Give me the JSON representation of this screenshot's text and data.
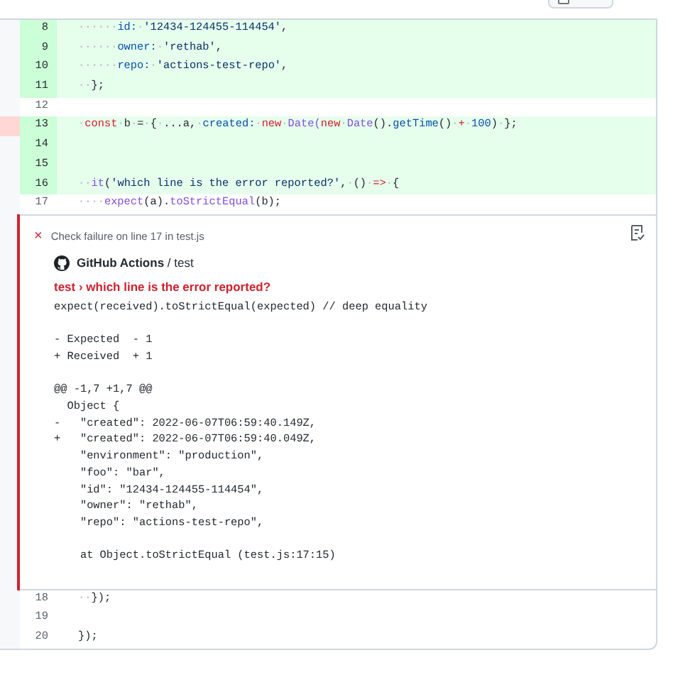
{
  "viewed_toggle": {
    "checked": false
  },
  "lines_before": [
    {
      "number": "8",
      "added": true,
      "marked": false,
      "tokens": [
        {
          "kind": "ws",
          "text": "······"
        },
        {
          "kind": "key",
          "text": "id:"
        },
        {
          "kind": "ws",
          "text": "·"
        },
        {
          "kind": "str",
          "text": "'12434-124455-114454'"
        },
        {
          "kind": "plain",
          "text": ","
        }
      ]
    },
    {
      "number": "9",
      "added": true,
      "marked": false,
      "tokens": [
        {
          "kind": "ws",
          "text": "······"
        },
        {
          "kind": "key",
          "text": "owner:"
        },
        {
          "kind": "ws",
          "text": "·"
        },
        {
          "kind": "str",
          "text": "'rethab'"
        },
        {
          "kind": "plain",
          "text": ","
        }
      ]
    },
    {
      "number": "10",
      "added": true,
      "marked": false,
      "tokens": [
        {
          "kind": "ws",
          "text": "······"
        },
        {
          "kind": "key",
          "text": "repo:"
        },
        {
          "kind": "ws",
          "text": "·"
        },
        {
          "kind": "str",
          "text": "'actions-test-repo'"
        },
        {
          "kind": "plain",
          "text": ","
        }
      ]
    },
    {
      "number": "11",
      "added": true,
      "marked": false,
      "tokens": [
        {
          "kind": "ws",
          "text": "··"
        },
        {
          "kind": "plain",
          "text": "};"
        }
      ]
    },
    {
      "number": "12",
      "added": false,
      "marked": false
    },
    {
      "number": "13",
      "added": true,
      "marked": true,
      "tokens": [
        {
          "kind": "ws",
          "text": "·"
        },
        {
          "kind": "kw",
          "text": "const"
        },
        {
          "kind": "ws",
          "text": "·"
        },
        {
          "kind": "plain",
          "text": "b"
        },
        {
          "kind": "ws",
          "text": "·"
        },
        {
          "kind": "plain",
          "text": "="
        },
        {
          "kind": "ws",
          "text": "·"
        },
        {
          "kind": "plain",
          "text": "{"
        },
        {
          "kind": "ws",
          "text": "·"
        },
        {
          "kind": "plain",
          "text": "...a,"
        },
        {
          "kind": "ws",
          "text": "·"
        },
        {
          "kind": "key",
          "text": "created:"
        },
        {
          "kind": "ws",
          "text": "·"
        },
        {
          "kind": "kw",
          "text": "new"
        },
        {
          "kind": "ws",
          "text": "·"
        },
        {
          "kind": "fn",
          "text": "Date("
        },
        {
          "kind": "kw",
          "text": "new"
        },
        {
          "kind": "ws",
          "text": "·"
        },
        {
          "kind": "fn",
          "text": "Date"
        },
        {
          "kind": "plain",
          "text": "()."
        },
        {
          "kind": "key",
          "text": "getTime"
        },
        {
          "kind": "plain",
          "text": "()"
        },
        {
          "kind": "ws",
          "text": "·"
        },
        {
          "kind": "kw",
          "text": "+"
        },
        {
          "kind": "ws",
          "text": "·"
        },
        {
          "kind": "key",
          "text": "100"
        },
        {
          "kind": "plain",
          "text": ")"
        },
        {
          "kind": "ws",
          "text": "·"
        },
        {
          "kind": "plain",
          "text": "};"
        }
      ]
    },
    {
      "number": "14",
      "added": true,
      "marked": false
    },
    {
      "number": "15",
      "added": true,
      "marked": false
    },
    {
      "number": "16",
      "added": true,
      "marked": false,
      "tokens": [
        {
          "kind": "ws",
          "text": "··"
        },
        {
          "kind": "fn",
          "text": "it"
        },
        {
          "kind": "plain",
          "text": "("
        },
        {
          "kind": "str",
          "text": "'which line is the error reported?'"
        },
        {
          "kind": "plain",
          "text": ","
        },
        {
          "kind": "ws",
          "text": "·"
        },
        {
          "kind": "plain",
          "text": "()"
        },
        {
          "kind": "ws",
          "text": "·"
        },
        {
          "kind": "kw",
          "text": "=>"
        },
        {
          "kind": "ws",
          "text": "·"
        },
        {
          "kind": "plain",
          "text": "{"
        }
      ]
    },
    {
      "number": "17",
      "added": false,
      "marked": false,
      "tokens": [
        {
          "kind": "ws",
          "text": "····"
        },
        {
          "kind": "fn",
          "text": "expect"
        },
        {
          "kind": "plain",
          "text": "(a)."
        },
        {
          "kind": "fn",
          "text": "toStrictEqual"
        },
        {
          "kind": "plain",
          "text": "(b);"
        }
      ]
    }
  ],
  "annotation": {
    "icon": "×",
    "summary": "Check failure on line 17 in test.js",
    "source": "**GitHub Actions** / test",
    "title": "test › which line is the error reported?",
    "message_blocks": [
      [
        "expect(received).toStrictEqual(expected) // deep equality"
      ],
      [
        "- Expected  - 1",
        "+ Received  + 1"
      ],
      [
        "@@ -1,7 +1,7 @@",
        "  Object {",
        "-   \"created\": 2022-06-07T06:59:40.149Z,",
        "+   \"created\": 2022-06-07T06:59:40.049Z,",
        "    \"environment\": \"production\",",
        "    \"foo\": \"bar\",",
        "    \"id\": \"12434-124455-114454\",",
        "    \"owner\": \"rethab\",",
        "    \"repo\": \"actions-test-repo\","
      ],
      [
        "    at Object.toStrictEqual (test.js:17:15)"
      ]
    ]
  },
  "lines_after": [
    {
      "number": "18",
      "added": false,
      "marked": false,
      "tokens": [
        {
          "kind": "ws",
          "text": "··"
        },
        {
          "kind": "plain",
          "text": "});"
        }
      ]
    },
    {
      "number": "19",
      "added": false,
      "marked": false
    },
    {
      "number": "20",
      "added": false,
      "marked": false,
      "tokens": [
        {
          "kind": "plain",
          "text": "});"
        }
      ]
    }
  ]
}
